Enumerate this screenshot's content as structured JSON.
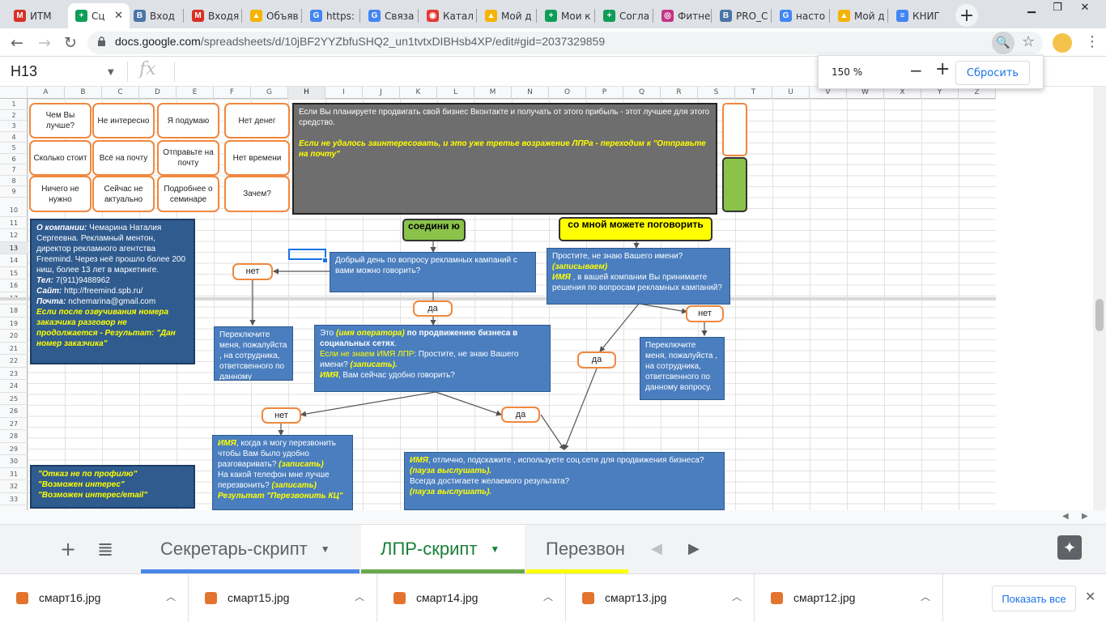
{
  "browser": {
    "tabs": [
      {
        "label": "ИТМ",
        "icon": "gmail-icon",
        "color": "#d93025",
        "glyph": "M"
      },
      {
        "label": "Сц",
        "icon": "sheets-icon",
        "color": "#0f9d58",
        "glyph": "+",
        "active": true
      },
      {
        "label": "Вход",
        "icon": "vk-icon",
        "color": "#4a76a8",
        "glyph": "В"
      },
      {
        "label": "Входя",
        "icon": "gmail-icon",
        "color": "#d93025",
        "glyph": "M"
      },
      {
        "label": "Объяв",
        "icon": "drive-icon",
        "color": "#f4b400",
        "glyph": "▲"
      },
      {
        "label": "https:",
        "icon": "google-icon",
        "color": "#4285f4",
        "glyph": "G"
      },
      {
        "label": "Связа",
        "icon": "google-icon",
        "color": "#4285f4",
        "glyph": "G"
      },
      {
        "label": "Катал",
        "icon": "shop-icon",
        "color": "#e53935",
        "glyph": "◉"
      },
      {
        "label": "Мой д",
        "icon": "drive-icon",
        "color": "#f4b400",
        "glyph": "▲"
      },
      {
        "label": "Мои к",
        "icon": "sheets-icon",
        "color": "#0f9d58",
        "glyph": "+"
      },
      {
        "label": "Согла",
        "icon": "sheets-icon",
        "color": "#0f9d58",
        "glyph": "+"
      },
      {
        "label": "Фитне",
        "icon": "instagram-icon",
        "color": "#c13584",
        "glyph": "◎"
      },
      {
        "label": "PRO_С",
        "icon": "vk-icon",
        "color": "#4a76a8",
        "glyph": "В"
      },
      {
        "label": "насто",
        "icon": "google-icon",
        "color": "#4285f4",
        "glyph": "G"
      },
      {
        "label": "Мой д",
        "icon": "drive-icon",
        "color": "#f4b400",
        "glyph": "▲"
      },
      {
        "label": "КНИГ",
        "icon": "docs-icon",
        "color": "#4285f4",
        "glyph": "≡"
      }
    ],
    "close_glyph": "✕",
    "newtab_glyph": "+",
    "url_main": "docs.google.com",
    "url_rest": "/spreadsheets/d/10jBF2YYZbfuSHQ2_un1tvtxDIBHsb4XP/edit#gid=2037329859",
    "zoom_popup": {
      "value": "150 %",
      "minus": "−",
      "plus": "+",
      "reset": "Сбросить"
    }
  },
  "formula_bar": {
    "cell_ref": "H13",
    "fx": "fx"
  },
  "columns": [
    "A",
    "B",
    "C",
    "D",
    "E",
    "F",
    "G",
    "H",
    "I",
    "J",
    "K",
    "L",
    "M",
    "N",
    "O",
    "P",
    "Q",
    "R",
    "S",
    "T",
    "U",
    "V",
    "W",
    "X",
    "Y",
    "Z"
  ],
  "rows": [
    "1",
    "2",
    "3",
    "4",
    "5",
    "6",
    "7",
    "8",
    "9",
    "10",
    "11",
    "12",
    "13",
    "14",
    "15",
    "16",
    "17",
    "18",
    "19",
    "20",
    "21",
    "22",
    "23",
    "24",
    "25",
    "26",
    "27",
    "28",
    "29",
    "30",
    "31",
    "32",
    "33"
  ],
  "objections": [
    [
      "Чем Вы лучше?",
      "Не интересно",
      "Я подумаю",
      "Нет денег"
    ],
    [
      "Сколько стоит",
      "Всё на почту",
      "Отправьте на почту",
      "Нет времени"
    ],
    [
      "Ничего не нужно",
      "Сейчас не актуально",
      "Подробнее о семинаре",
      "Зачем?"
    ]
  ],
  "gray_box": {
    "line1": "Если Вы планируете продвигать свой бизнес Вконтакте и получать от этого прибыль - этот лучшее для этого средство.",
    "line2": "Если не удалось заинтересовать, и это уже третье возражение ЛПРа  - переходим к \"Отправьте на почту\""
  },
  "company_box": {
    "label": "О компании:",
    "text1": " Чемарина Наталия Сергеевна. Рекламный ментон, директор рекламного агентства Freemind. Через неё прошло более 200 ниш, более 13 лет в маркетинге.",
    "tel_label": "Тел:",
    "tel": " 7(911)9488962",
    "site_label": "Сайт:",
    "site": " http://freemind.spb.ru/",
    "mail_label": "Почта:",
    "mail": " nchemarina@gmail.com",
    "note": "Если после озвучивания номера заказчика разговор не продолжается  - Результат: \"Дан номер заказчика\""
  },
  "results_box": {
    "l1": "\"Отказ не по профилю\"",
    "l2": "\"Возможен интерес\"",
    "l3": "\"Возможен интерес/email\""
  },
  "chip_green": "соедини ю",
  "chip_yellow": "со мной можете поговорить",
  "box_greeting": "Добрый день по вопросу  рекламных кампаний с вами можно говорить?",
  "box_name": {
    "l1": "Простите, не знаю Вашего имени?",
    "l2": "(записываем)",
    "l3a": "ИМЯ",
    "l3b": " , в вашей компании Вы принимаете решения по вопросам рекламных кампаний?"
  },
  "box_operator": {
    "a": "Это ",
    "b": "(имя оператора)",
    "c": "  по продвижению бизнеса в социальных сетях",
    "d": ".",
    "e": "Если не знаем ИМЯ ЛПР",
    "f": ": Простите, не знаю Вашего имени? ",
    "g": "(записать).",
    "h": "ИМЯ",
    "i": ", Вам сейчас удобно говорить?"
  },
  "box_switch_left": "Переключите меня, пожалуйста , на сотрудника, ответсвенного по данному",
  "box_switch_right": "Переключите меня, пожалуйста , на сотрудника, ответсвенного по данному вопросу.",
  "box_callback": {
    "a": "ИМЯ",
    "b": ", когда я могу перезвонить чтобы Вам было удобно разговаривать? ",
    "c": "(записать)",
    "d": "На какой телефон мне лучше перезвонить? ",
    "e": "(записать)",
    "f": "Результат \"Перезвонить КЦ\""
  },
  "box_final": {
    "a": "ИМЯ",
    "b": ",  отлично, подскажите , используете соц.сети для продвижения бизнеса?",
    "c": "(пауза выслушать).",
    "d": "Всегда достигаете желаемого результата?",
    "e": "(пауза выслушать)."
  },
  "yes": "да",
  "no": "нет",
  "sheet_tabs": [
    {
      "label": "Секретарь-скрипт",
      "color": "#4a86e8"
    },
    {
      "label": "ЛПР-скрипт",
      "color": "#6aa84f",
      "active": true
    },
    {
      "label": "Перезвон",
      "color": "#ffff00"
    }
  ],
  "downloads": [
    "смарт16.jpg",
    "смарт15.jpg",
    "смарт14.jpg",
    "смарт13.jpg",
    "смарт12.jpg"
  ],
  "show_all": "Показать все"
}
